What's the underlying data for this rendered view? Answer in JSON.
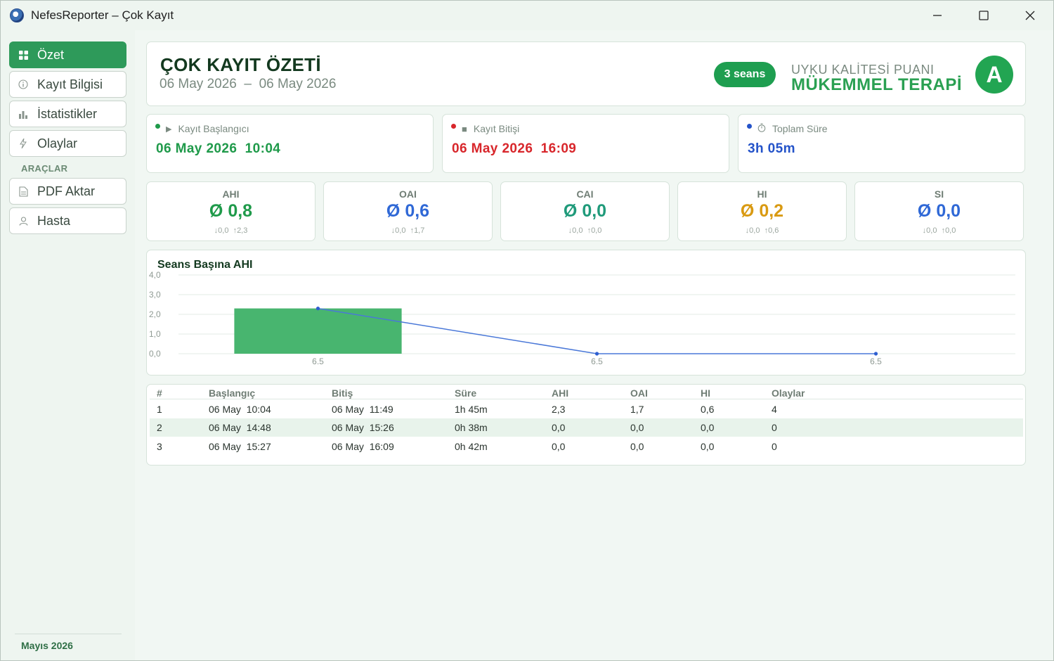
{
  "window": {
    "title": "NefesReporter – Çok Kayıt",
    "controls": {
      "minimize": "minimize-icon",
      "maximize": "maximize-icon",
      "close": "close-icon"
    }
  },
  "sidebar": {
    "items": [
      {
        "label": "Özet",
        "icon": "grid-icon",
        "active": true
      },
      {
        "label": "Kayıt Bilgisi",
        "icon": "info-icon",
        "active": false
      },
      {
        "label": "İstatistikler",
        "icon": "bar-chart-icon",
        "active": false
      },
      {
        "label": "Olaylar",
        "icon": "lightning-icon",
        "active": false
      }
    ],
    "section_label": "ARAÇLAR",
    "tools": [
      {
        "label": "PDF Aktar",
        "icon": "document-icon"
      },
      {
        "label": "Hasta",
        "icon": "user-icon"
      }
    ],
    "footer": "Mayıs 2026"
  },
  "header": {
    "title": "ÇOK KAYIT ÖZETİ",
    "range_start": "06 May 2026",
    "range_sep": "–",
    "range_end": "06 May 2026",
    "sessions_badge": "3 seans",
    "quality_label": "UYKU KALİTESİ PUANI",
    "quality_value": "MÜKEMMEL TERAPİ",
    "grade": "A"
  },
  "times": [
    {
      "label": "Kayıt Başlangıcı",
      "value": "06 May 2026  10:04",
      "color": "#1f9a4a",
      "icon": "play-icon"
    },
    {
      "label": "Kayıt Bitişi",
      "value": "06 May 2026  16:09",
      "color": "#d8262b",
      "icon": "stop-icon"
    },
    {
      "label": "Toplam Süre",
      "value": "3h 05m",
      "color": "#2453c9",
      "icon": "stopwatch-icon"
    }
  ],
  "metrics": [
    {
      "label": "AHI",
      "value": "Ø 0,8",
      "min": "↓0,0",
      "max": "↑2,3",
      "color": "#1f9a4a"
    },
    {
      "label": "OAI",
      "value": "Ø 0,6",
      "min": "↓0,0",
      "max": "↑1,7",
      "color": "#2f68d6"
    },
    {
      "label": "CAI",
      "value": "Ø 0,0",
      "min": "↓0,0",
      "max": "↑0,0",
      "color": "#1f9a7a"
    },
    {
      "label": "HI",
      "value": "Ø 0,2",
      "min": "↓0,0",
      "max": "↑0,6",
      "color": "#d99a12"
    },
    {
      "label": "SI",
      "value": "Ø 0,0",
      "min": "↓0,0",
      "max": "↑0,0",
      "color": "#2f68d6"
    }
  ],
  "chart_data": {
    "type": "bar",
    "title": "Seans Başına AHI",
    "categories": [
      "6.5",
      "6.5",
      "6.5"
    ],
    "series": [
      {
        "type": "bar",
        "values": [
          2.3,
          0.0,
          0.0
        ],
        "color": "#48b56f"
      },
      {
        "type": "line",
        "values": [
          2.3,
          0.0,
          0.0
        ],
        "color": "#4a78d8"
      }
    ],
    "yticks": [
      "4,0",
      "3,0",
      "2,0",
      "1,0",
      "0,0"
    ],
    "ylim": [
      0,
      4
    ],
    "grid": true
  },
  "table": {
    "headers": [
      "#",
      "Başlangıç",
      "Bitiş",
      "Süre",
      "AHI",
      "OAI",
      "HI",
      "Olaylar"
    ],
    "rows": [
      [
        "1",
        "06 May  10:04",
        "06 May  11:49",
        "1h 45m",
        "2,3",
        "1,7",
        "0,6",
        "4"
      ],
      [
        "2",
        "06 May  14:48",
        "06 May  15:26",
        "0h 38m",
        "0,0",
        "0,0",
        "0,0",
        "0"
      ],
      [
        "3",
        "06 May  15:27",
        "06 May  16:09",
        "0h 42m",
        "0,0",
        "0,0",
        "0,0",
        "0"
      ]
    ]
  }
}
